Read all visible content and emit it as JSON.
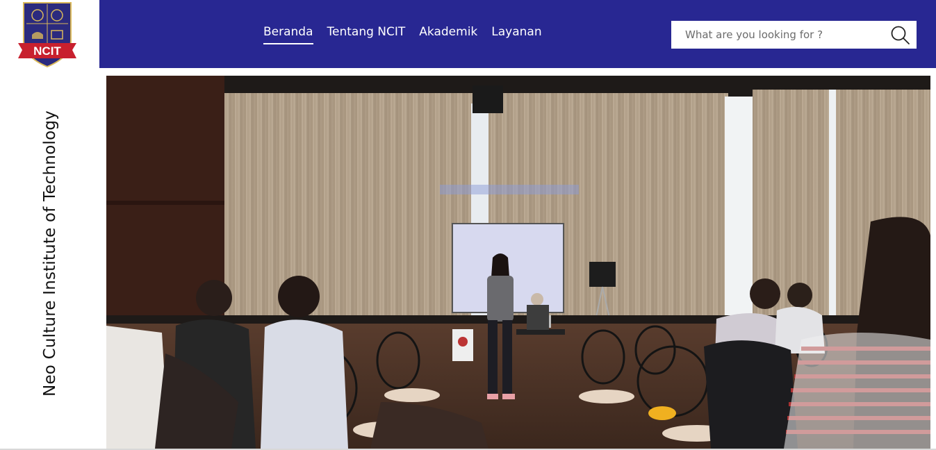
{
  "brand": {
    "logo_text": "NCIT",
    "site_name": "Neo Culture Institute of Technology",
    "colors": {
      "header": "#282792",
      "logo_ribbon": "#c8202e"
    }
  },
  "nav": {
    "items": [
      {
        "label": "Beranda",
        "active": true
      },
      {
        "label": "Tentang NCIT",
        "active": false
      },
      {
        "label": "Akademik",
        "active": false
      },
      {
        "label": "Layanan",
        "active": false
      }
    ]
  },
  "search": {
    "placeholder": "What are you looking for ?",
    "icon": "search-icon"
  },
  "hero": {
    "image": "classroom-presentation-photo"
  }
}
